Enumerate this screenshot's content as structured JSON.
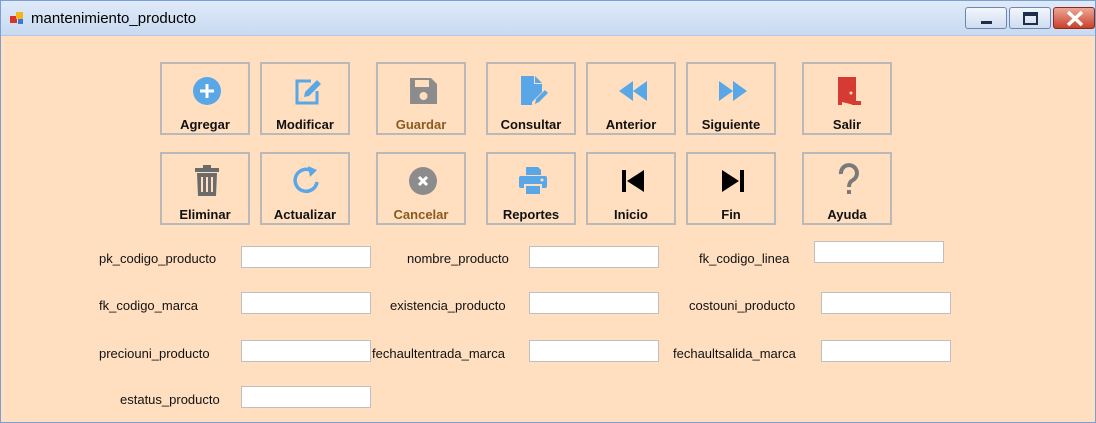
{
  "window": {
    "title": "mantenimiento_producto"
  },
  "toolbar": {
    "agregar": "Agregar",
    "modificar": "Modificar",
    "guardar": "Guardar",
    "consultar": "Consultar",
    "anterior": "Anterior",
    "siguiente": "Siguiente",
    "salir": "Salir",
    "eliminar": "Eliminar",
    "actualizar": "Actualizar",
    "cancelar": "Cancelar",
    "reportes": "Reportes",
    "inicio": "Inicio",
    "fin": "Fin",
    "ayuda": "Ayuda"
  },
  "fields": {
    "pk_codigo_producto": {
      "label": "pk_codigo_producto",
      "value": ""
    },
    "nombre_producto": {
      "label": "nombre_producto",
      "value": ""
    },
    "fk_codigo_linea": {
      "label": "fk_codigo_linea",
      "value": ""
    },
    "fk_codigo_marca": {
      "label": "fk_codigo_marca",
      "value": ""
    },
    "existencia_producto": {
      "label": "existencia_producto",
      "value": ""
    },
    "costouni_producto": {
      "label": "costouni_producto",
      "value": ""
    },
    "preciouni_producto": {
      "label": "preciouni_producto",
      "value": ""
    },
    "fechaultentrada_marca": {
      "label": "fechaultentrada_marca",
      "value": ""
    },
    "fechaultsalida_marca": {
      "label": "fechaultsalida_marca",
      "value": ""
    },
    "estatus_producto": {
      "label": "estatus_producto",
      "value": ""
    }
  },
  "colors": {
    "background": "#ffdfc0",
    "icon_blue": "#5aa7e8",
    "icon_gray": "#8c8c8c",
    "icon_red": "#d53a33",
    "disabled_text": "#8a5a20"
  },
  "icons": {
    "agregar": "plus-circle-icon",
    "modificar": "edit-icon",
    "guardar": "save-icon",
    "consultar": "file-edit-icon",
    "anterior": "rewind-icon",
    "siguiente": "fast-forward-icon",
    "salir": "door-exit-icon",
    "eliminar": "trash-icon",
    "actualizar": "refresh-icon",
    "cancelar": "cancel-circle-icon",
    "reportes": "printer-icon",
    "inicio": "skip-start-icon",
    "fin": "skip-end-icon",
    "ayuda": "question-icon"
  }
}
